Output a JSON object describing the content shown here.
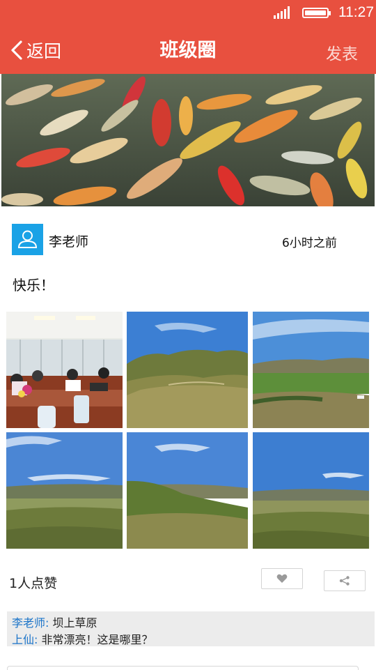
{
  "status_bar": {
    "time": "11:27",
    "signal_icon": "signal-icon",
    "battery_icon": "battery-icon"
  },
  "nav": {
    "back_label": "返回",
    "title": "班级圈",
    "publish_label": "发表"
  },
  "post": {
    "author": "李老师",
    "time": "6小时之前",
    "content": "快乐！",
    "photos": [
      "meeting-room-photo",
      "grassland-hills-photo",
      "grassland-valley-photo",
      "grassland-plain-photo",
      "grassland-slope-photo",
      "grassland-distance-photo"
    ],
    "likes_text": "1人点赞"
  },
  "comments": [
    {
      "name": "李老师",
      "separator": ": ",
      "text": "坝上草原"
    },
    {
      "name": "上仙",
      "separator": ": ",
      "text": "非常漂亮！这是哪里？"
    }
  ],
  "colors": {
    "accent": "#e8503f",
    "avatar": "#1aa2e6",
    "comment_name": "#1a73c8"
  }
}
